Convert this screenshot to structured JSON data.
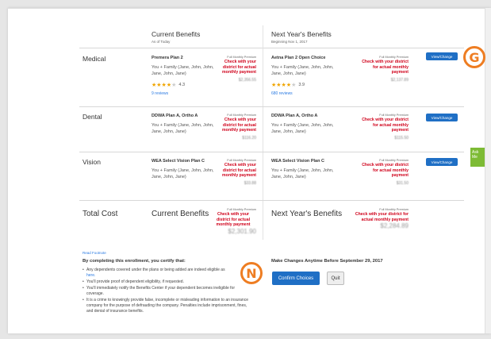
{
  "headers": {
    "current_title": "Current Benefits",
    "current_sub": "As of Today",
    "next_title": "Next Year's Benefits",
    "next_sub": "Beginning Nov 1, 2017"
  },
  "rows": {
    "medical": {
      "label": "Medical",
      "current": {
        "plan": "Premera Plan 2",
        "coverage": "You + Family (Jane, John, John, Jane, John, Jane)",
        "premium_label": "Full Monthly Premium",
        "check": "Check with your district for actual monthly payment",
        "amount": "$2,356.55",
        "rating": "4.3",
        "rating_value": 4.3,
        "reviews": "9 reviews"
      },
      "next": {
        "plan": "Aetna Plan 2 Open Choice",
        "coverage": "You + Family (Jane, John, John, Jane, John, Jane)",
        "premium_label": "Full Monthly Premium",
        "check": "Check with your district for actual monthly payment",
        "amount": "$2,137.89",
        "rating": "3.9",
        "rating_value": 3.9,
        "reviews": "680 reviews"
      },
      "button": "View/Change"
    },
    "dental": {
      "label": "Dental",
      "current": {
        "plan": "DDWA Plan A, Ortho A",
        "coverage": "You + Family (Jane, John, John, Jane, John, Jane)",
        "premium_label": "Full Monthly Premium",
        "check": "Check with your district for actual monthly payment",
        "amount": "$116.20"
      },
      "next": {
        "plan": "DDWA Plan A, Ortho A",
        "coverage": "You + Family (Jane, John, John, Jane, John, Jane)",
        "premium_label": "Full Monthly Premium",
        "check": "Check with your district for actual monthly payment",
        "amount": "$115.50"
      },
      "button": "View/Change"
    },
    "vision": {
      "label": "Vision",
      "current": {
        "plan": "WEA Select Vision Plan C",
        "coverage": "You + Family (Jane, John, John, Jane, John, Jane)",
        "premium_label": "Full Monthly Premium",
        "check": "Check with your district for actual monthly payment",
        "amount": "$33.88"
      },
      "next": {
        "plan": "WEA Select Vision Plan C",
        "coverage": "You + Family (Jane, John, John, Jane, John, Jane)",
        "premium_label": "Full Monthly Premium",
        "check": "Check with your district for actual monthly payment",
        "amount": "$31.50"
      },
      "button": "View/Change"
    }
  },
  "total": {
    "label": "Total Cost",
    "current_label": "Current Benefits",
    "next_label": "Next Year's Benefits",
    "premium_label": "Full Monthly Premium",
    "check": "Check with your district for actual monthly payment",
    "current_amount": "$2,301.90",
    "next_amount": "$2,284.89"
  },
  "footer": {
    "read_footnote": "Read Footnote",
    "cert_heading": "By completing this enrollment, you certify that:",
    "bullet1": "Any dependents covered under the plans or being added are indeed eligible as",
    "bullet1_link": "here.",
    "bullet2": "You'll provide proof of dependent eligibility, if requested.",
    "bullet3": "You'll immediately notify the Benefits Center if your dependent becomes ineligible for coverage.",
    "bullet4": "It is a crime to knowingly provide false, incomplete or misleading information to an insurance company for the purpose of defrauding the company. Penalties include imprisonment, fines, and denial of insurance benefits.",
    "make_changes": "Make Changes Anytime Before September 29, 2017",
    "confirm": "Confirm Choices",
    "quit": "Quit"
  },
  "ask_tab": "Ask Me",
  "badges": {
    "g": "G",
    "n": "N"
  },
  "colors": {
    "accent": "#1f6fc5",
    "warning": "#d0021b",
    "badge": "#ee7d22",
    "ask": "#7dbb35",
    "star": "#f0a500"
  }
}
